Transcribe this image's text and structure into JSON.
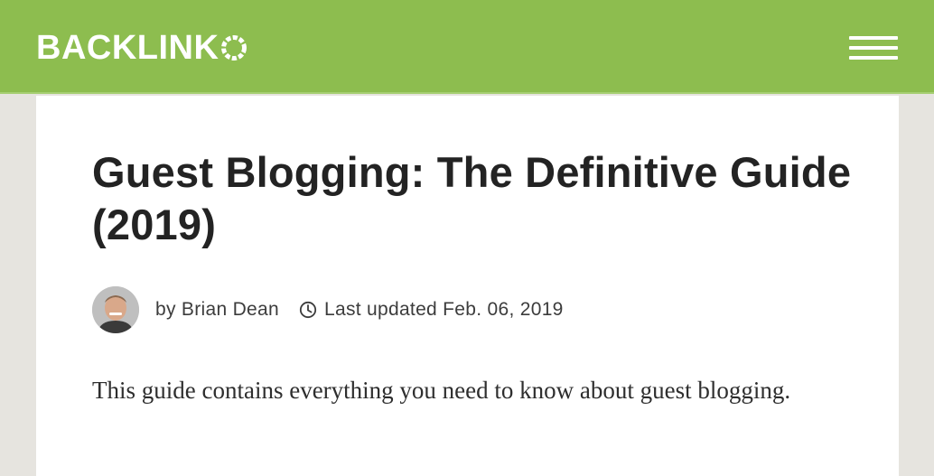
{
  "header": {
    "logo_text": "BACKLINK",
    "logo_last_letter": "O",
    "menu_icon": "hamburger-menu-icon",
    "background_color": "#8dbd4f"
  },
  "article": {
    "title": "Guest Blogging: The Definitive Guide (2019)",
    "author_byline": "by Brian Dean",
    "avatar_icon": "author-avatar",
    "clock_icon": "clock-icon",
    "updated_text": "Last updated Feb. 06, 2019",
    "intro": "This guide contains everything you need to know about guest blogging."
  }
}
